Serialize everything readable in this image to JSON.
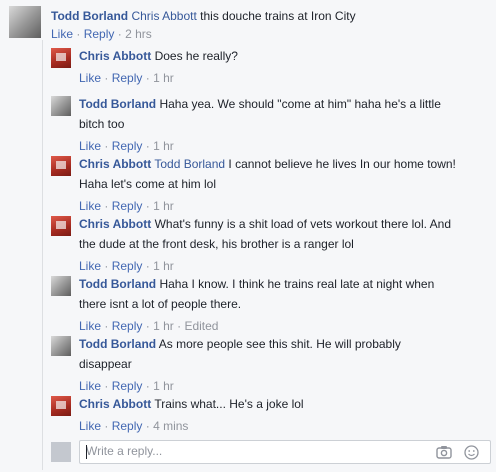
{
  "top_comment": {
    "author": "Todd Borland",
    "tag": "Chris Abbott",
    "text": "this douche trains at Iron City",
    "like": "Like",
    "reply": "Reply",
    "time": "2 hrs",
    "avatar_icon": "user-photo-icon"
  },
  "replies": [
    {
      "author": "Chris Abbott",
      "tag": "",
      "line1": "Does he really?",
      "line2": "",
      "like": "Like",
      "reply": "Reply",
      "time": "1 hr",
      "edited": ""
    },
    {
      "author": "Todd Borland",
      "tag": "",
      "line1": "Haha yea. We should \"come at him\" haha he's a little",
      "line2": "bitch too",
      "like": "Like",
      "reply": "Reply",
      "time": "1 hr",
      "edited": ""
    },
    {
      "author": "Chris Abbott",
      "tag": "Todd Borland",
      "line1": "I cannot believe he lives In our home town!",
      "line2": "Haha let's come at him lol",
      "like": "Like",
      "reply": "Reply",
      "time": "1 hr",
      "edited": ""
    },
    {
      "author": "Chris Abbott",
      "tag": "",
      "line1": "What's funny is a shit load of vets workout there lol. And",
      "line2": "the dude at the front desk, his brother is a ranger lol",
      "like": "Like",
      "reply": "Reply",
      "time": "1 hr",
      "edited": ""
    },
    {
      "author": "Todd Borland",
      "tag": "",
      "line1": "Haha I know. I think he trains real late at night when",
      "line2": "there isnt a lot of people there.",
      "like": "Like",
      "reply": "Reply",
      "time": "1 hr",
      "edited": "Edited"
    },
    {
      "author": "Todd Borland",
      "tag": "",
      "line1": "As more people see this shit. He will probably",
      "line2": "disappear",
      "like": "Like",
      "reply": "Reply",
      "time": "1 hr",
      "edited": ""
    },
    {
      "author": "Chris Abbott",
      "tag": "",
      "line1": "Trains what... He's a joke lol",
      "line2": "",
      "like": "Like",
      "reply": "Reply",
      "time": "4 mins",
      "edited": ""
    }
  ],
  "composer": {
    "placeholder": "Write a reply...",
    "camera_icon": "camera-icon",
    "emoji_icon": "emoji-icon"
  },
  "colors": {
    "name": "#365899",
    "link": "#4267b2",
    "meta": "#90949c",
    "background": "#f6f7f9"
  }
}
